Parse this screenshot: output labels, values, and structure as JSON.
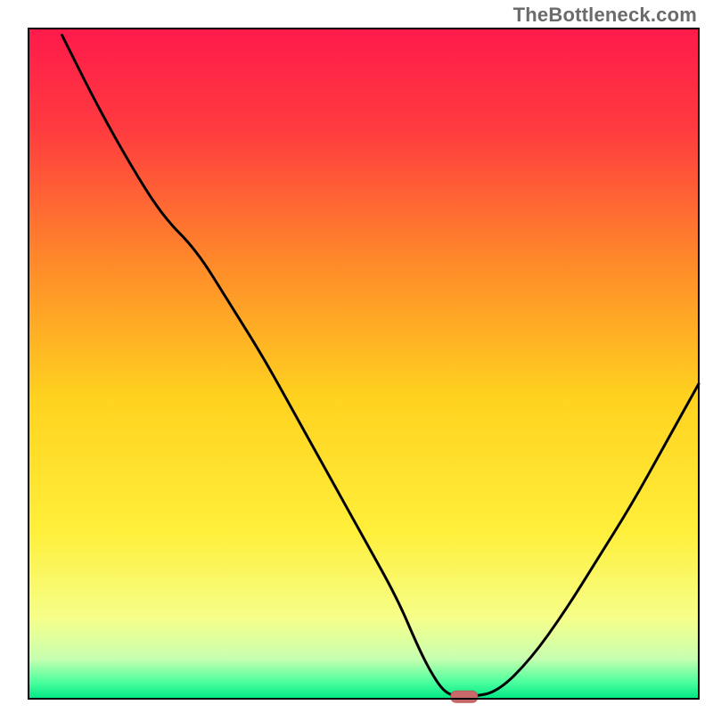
{
  "watermark": "TheBottleneck.com",
  "chart_data": {
    "type": "line",
    "title": "",
    "xlabel": "",
    "ylabel": "",
    "xlim": [
      0,
      100
    ],
    "ylim": [
      0,
      100
    ],
    "annotations": [],
    "series": [
      {
        "name": "bottleneck-curve",
        "x": [
          5,
          10,
          15,
          20,
          25,
          30,
          35,
          40,
          45,
          50,
          55,
          58,
          60,
          62,
          64,
          66,
          70,
          75,
          80,
          85,
          90,
          95,
          100
        ],
        "y": [
          99,
          89,
          80,
          72,
          67,
          59,
          51,
          42,
          33,
          24,
          15,
          8,
          4,
          1,
          0.3,
          0.3,
          1,
          6,
          13,
          21,
          29,
          38,
          47
        ]
      }
    ],
    "marker": {
      "x": 65,
      "y": 0.3
    },
    "background_gradient": {
      "stops": [
        {
          "offset": 0.0,
          "color": "#ff1a4b"
        },
        {
          "offset": 0.15,
          "color": "#ff3b3f"
        },
        {
          "offset": 0.35,
          "color": "#ff8a2a"
        },
        {
          "offset": 0.55,
          "color": "#ffd21f"
        },
        {
          "offset": 0.75,
          "color": "#ffef3a"
        },
        {
          "offset": 0.88,
          "color": "#f6ff8a"
        },
        {
          "offset": 0.94,
          "color": "#c8ffb0"
        },
        {
          "offset": 0.975,
          "color": "#4dff9e"
        },
        {
          "offset": 1.0,
          "color": "#00e885"
        }
      ]
    },
    "colors": {
      "curve": "#000000",
      "frame": "#000000",
      "marker_fill": "#c96a6a",
      "marker_stroke": "#b85a5a"
    },
    "plot_geometry": {
      "inner_x": 32,
      "inner_y": 32,
      "inner_w": 752,
      "inner_h": 752,
      "frame_stroke_w": 2,
      "curve_stroke_w": 3
    }
  }
}
